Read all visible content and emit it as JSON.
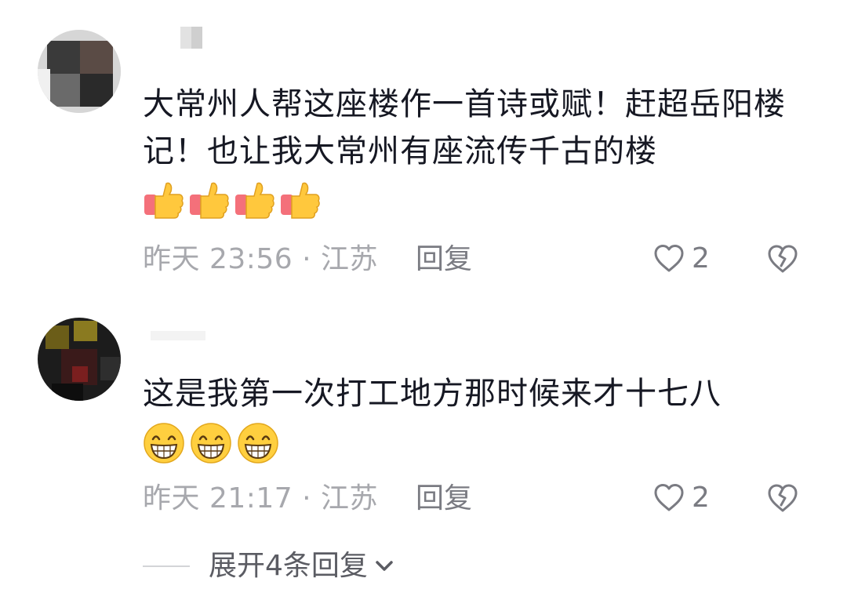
{
  "comments": [
    {
      "text": "大常州人帮这座楼作一首诗或赋！赶超岳阳楼记！也让我大常州有座流传千古的楼",
      "emoji": [
        "thumbs-up-icon",
        "thumbs-up-icon",
        "thumbs-up-icon",
        "thumbs-up-icon"
      ],
      "time": "昨天 23:56 · 江苏",
      "reply_label": "回复",
      "likes": "2"
    },
    {
      "text": "这是我第一次打工地方那时候来才十七八",
      "emoji": [
        "grinning-face-icon",
        "grinning-face-icon",
        "grinning-face-icon"
      ],
      "time": "昨天 21:17 · 江苏",
      "reply_label": "回复",
      "likes": "2"
    }
  ],
  "expand_replies": {
    "label": "展开4条回复"
  }
}
